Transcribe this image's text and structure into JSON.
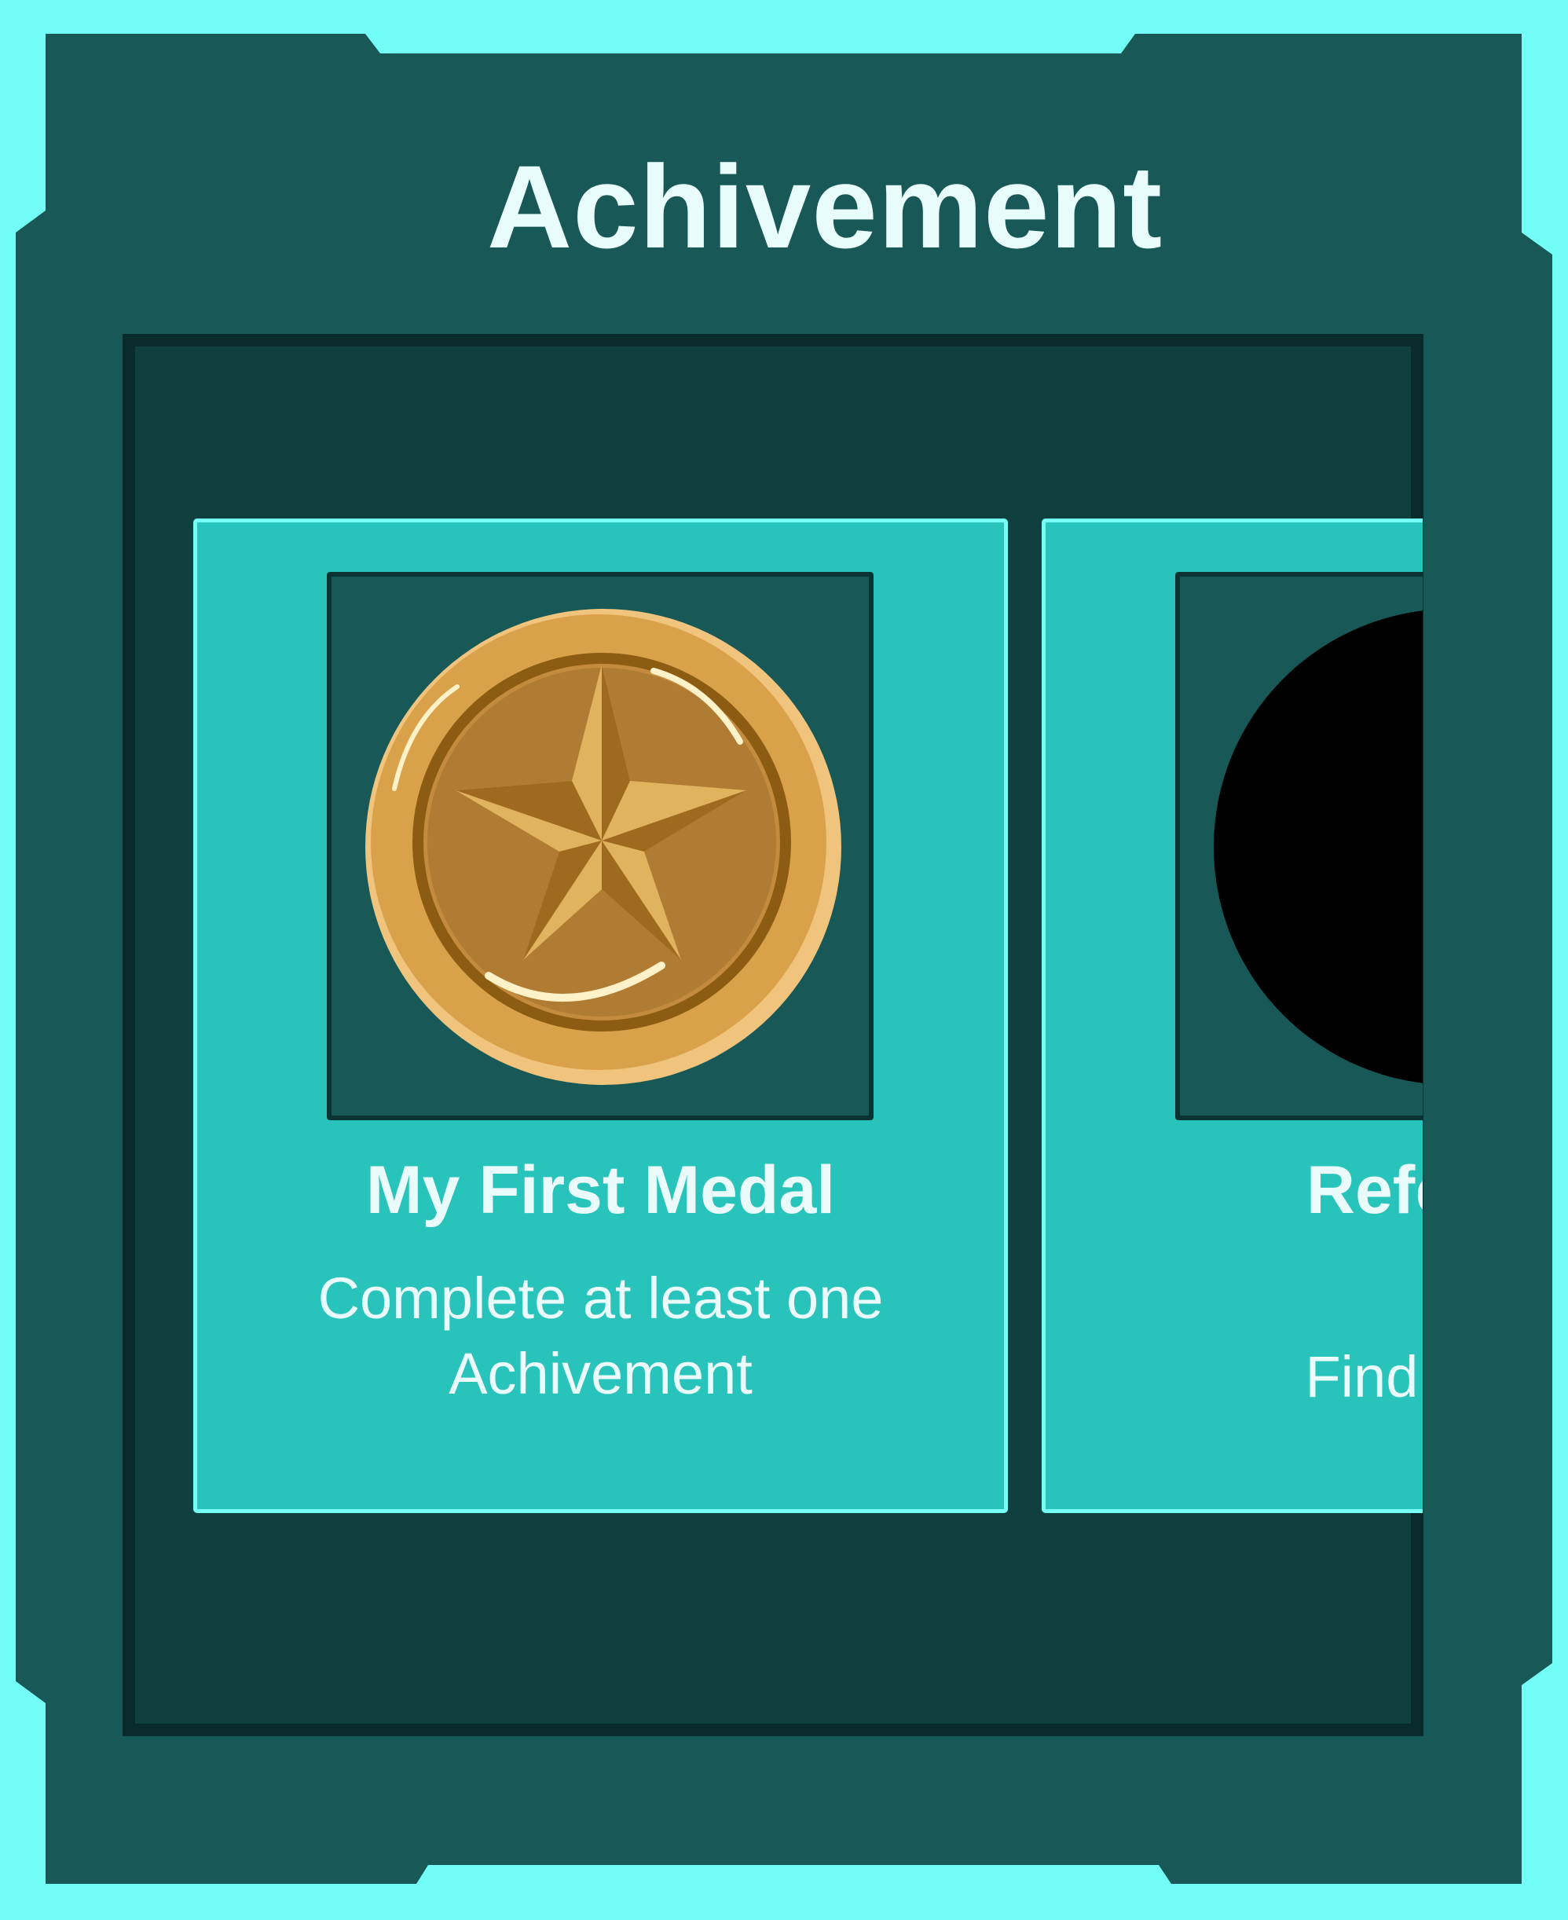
{
  "header": {
    "title": "Achivement"
  },
  "colors": {
    "outer_glow": "#72fef6",
    "frame": "#185857",
    "inner_panel": "#103f40",
    "card": "#28c3bb",
    "card_border": "#76fff5",
    "text": "#e9fbfa",
    "medal_gold": "#d9a24a",
    "locked_medal": "#000000"
  },
  "achievements": [
    {
      "title": "My First Medal",
      "description": "Complete at least one Achivement",
      "icon": "gold-star-medal-icon",
      "unlocked": true
    },
    {
      "title": "Refer Me",
      "description": "Find All the",
      "icon": "locked-medal-icon",
      "unlocked": false
    }
  ]
}
